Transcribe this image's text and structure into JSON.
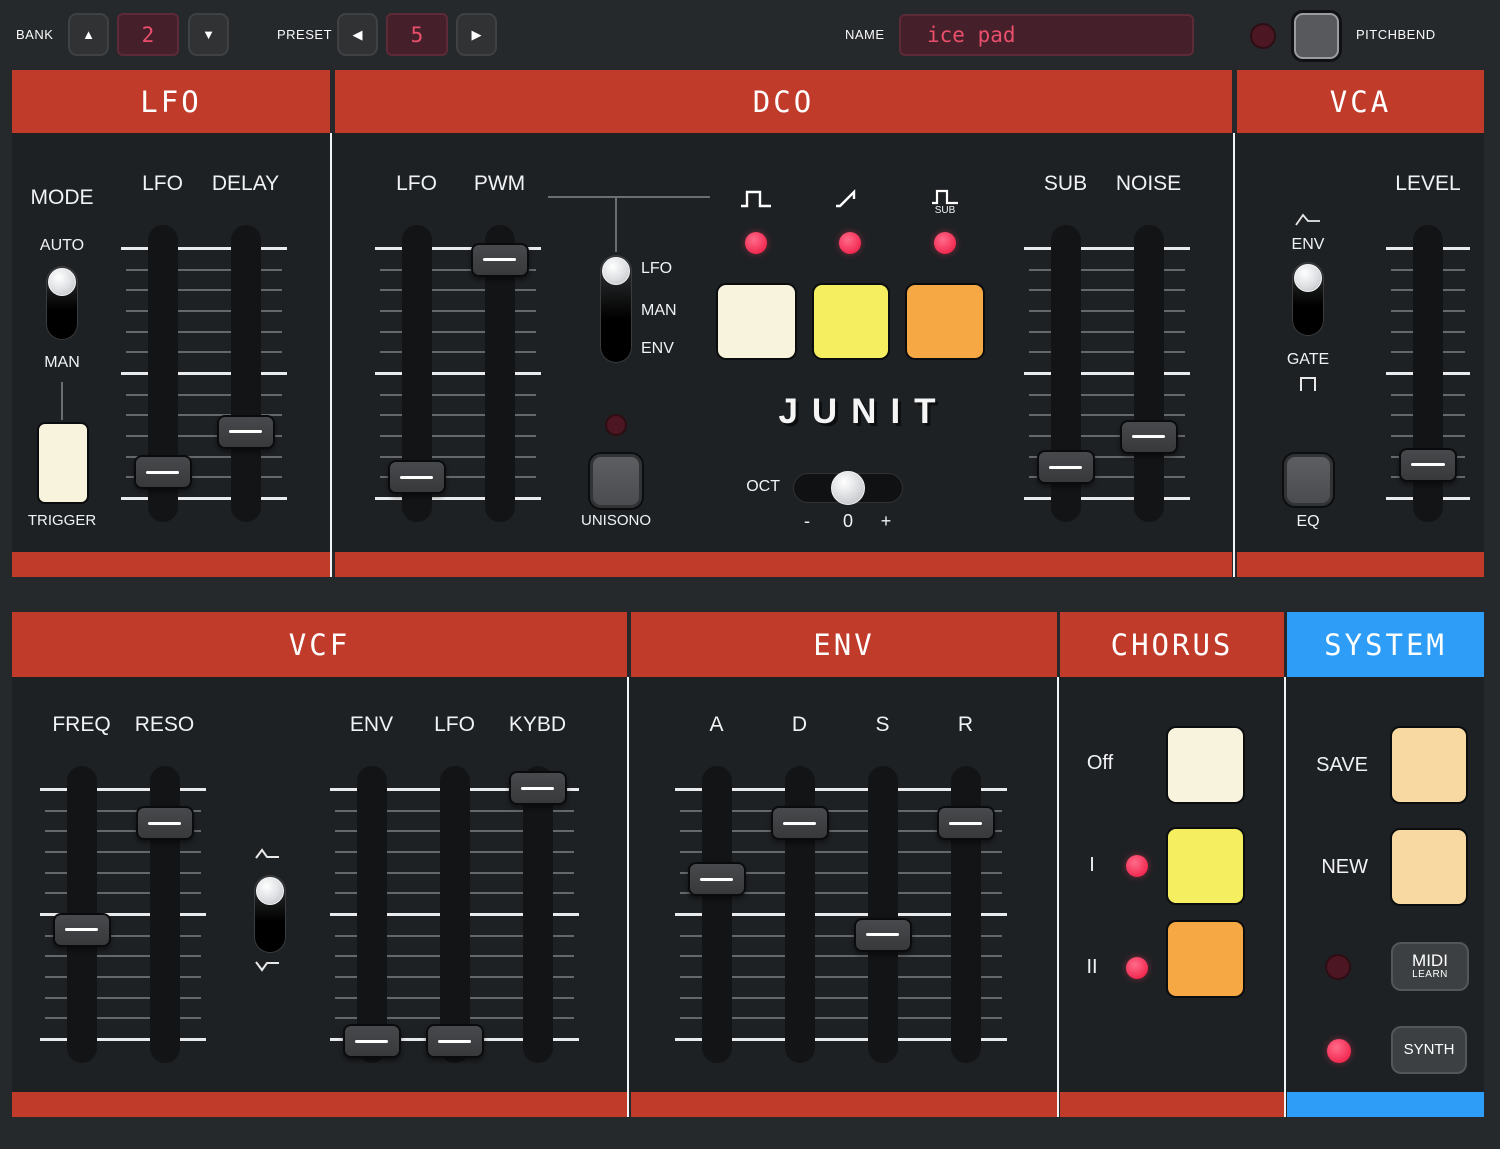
{
  "topbar": {
    "bank_label": "BANK",
    "bank_value": "2",
    "bank_up_icon": "▲",
    "bank_down_icon": "▼",
    "preset_label": "PRESET",
    "preset_value": "5",
    "preset_prev_icon": "◀",
    "preset_next_icon": "▶",
    "name_label": "NAME",
    "name_value": "ice pad",
    "pitchbend_led": "off",
    "pitchbend_label": "PITCHBEND"
  },
  "sections": {
    "lfo": {
      "title": "LFO",
      "mode_label": "MODE",
      "mode_value": "AUTO",
      "auto_label": "AUTO",
      "man_label": "MAN",
      "trigger_label": "TRIGGER",
      "sliders": [
        {
          "label": "LFO",
          "value": 89
        },
        {
          "label": "DELAY",
          "value": 73
        }
      ]
    },
    "dco": {
      "title": "DCO",
      "sliders_left": [
        {
          "label": "LFO",
          "value": 91
        },
        {
          "label": "PWM",
          "value": 5
        }
      ],
      "pwm_source": {
        "selected": "LFO",
        "options": [
          "LFO",
          "MAN",
          "ENV"
        ]
      },
      "waves": [
        {
          "name": "pulse",
          "led": "on"
        },
        {
          "name": "saw",
          "led": "on"
        },
        {
          "name": "sub-square",
          "led": "on",
          "sub_label": "SUB"
        }
      ],
      "logo": "JUNIT",
      "oct": {
        "label": "OCT",
        "value": "0",
        "minus_label": "-",
        "zero_label": "0",
        "plus_label": "+"
      },
      "unisono": {
        "label": "UNISONO",
        "led": "off"
      },
      "sliders_right": [
        {
          "label": "SUB",
          "value": 87
        },
        {
          "label": "NOISE",
          "value": 75
        }
      ]
    },
    "vca": {
      "title": "VCA",
      "env_label": "ENV",
      "gate_label": "GATE",
      "mode_value": "ENV",
      "eq_label": "EQ",
      "slider": {
        "label": "LEVEL",
        "value": 86
      }
    },
    "vcf": {
      "title": "VCF",
      "sliders_left": [
        {
          "label": "FREQ",
          "value": 56
        },
        {
          "label": "RESO",
          "value": 14
        }
      ],
      "polarity_value": "positive",
      "sliders_right": [
        {
          "label": "ENV",
          "value": 100
        },
        {
          "label": "LFO",
          "value": 100
        },
        {
          "label": "KYBD",
          "value": 0
        }
      ]
    },
    "envelope": {
      "title": "ENV",
      "sliders": [
        {
          "label": "A",
          "value": 36
        },
        {
          "label": "D",
          "value": 14
        },
        {
          "label": "S",
          "value": 58
        },
        {
          "label": "R",
          "value": 14
        }
      ]
    },
    "chorus": {
      "title": "CHORUS",
      "modes": [
        {
          "label": "Off"
        },
        {
          "label": "I",
          "led": "on"
        },
        {
          "label": "II",
          "led": "on"
        }
      ]
    },
    "system": {
      "title": "SYSTEM",
      "save_label": "SAVE",
      "new_label": "NEW",
      "midi_learn_line1": "MIDI",
      "midi_learn_line2": "LEARN",
      "midi_led": "off",
      "synth_label": "SYNTH",
      "synth_led": "on"
    }
  },
  "colors": {
    "header_red": "#c13b2b",
    "system_blue": "#2e9df7",
    "led_on_pink": "#f43a5e",
    "led_off_maroon": "#4c1722",
    "button_cream": "#f7f3dc",
    "button_yellow": "#f5ee61",
    "button_orange": "#f5a844",
    "button_tan": "#f8d9a2",
    "value_text_pink": "#ea4f6b"
  }
}
